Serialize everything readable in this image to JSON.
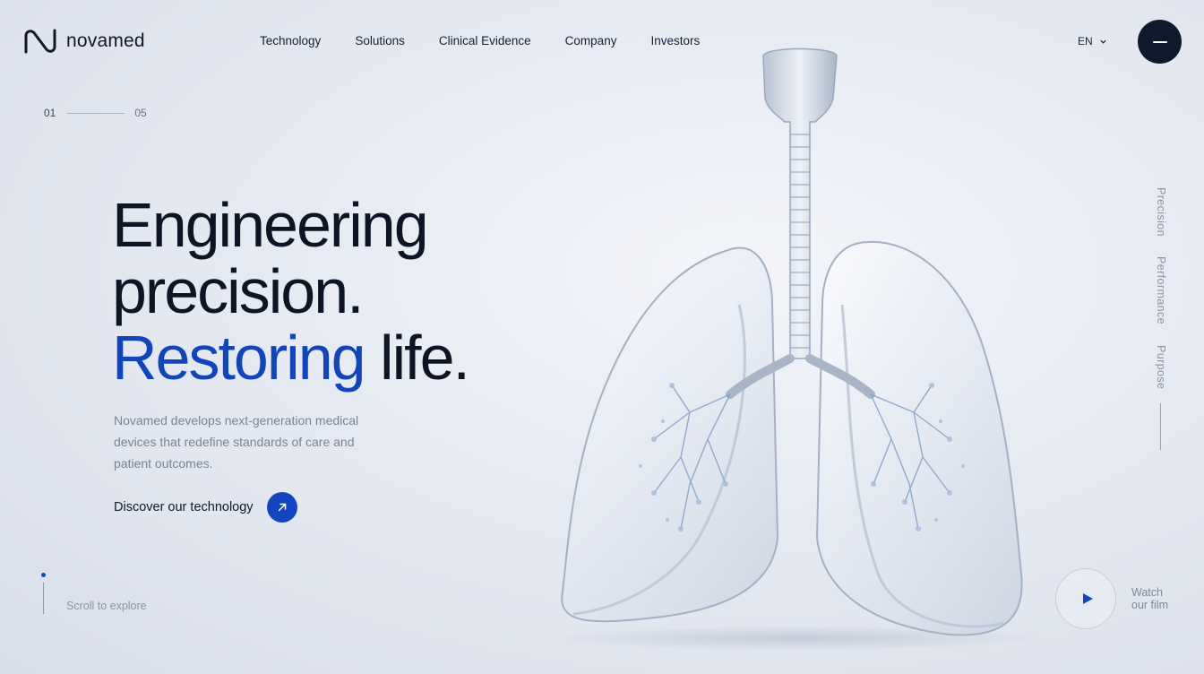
{
  "brand": {
    "name": "novamed"
  },
  "nav": {
    "items": [
      "Technology",
      "Solutions",
      "Clinical Evidence",
      "Company",
      "Investors"
    ]
  },
  "language": {
    "selected": "EN"
  },
  "counter": {
    "current": "01",
    "total": "05"
  },
  "hero": {
    "line1": "Engineering",
    "line2": "precision.",
    "line3_accent": "Restoring",
    "line3_rest": "life.",
    "description": "Novamed develops next-generation medical devices that redefine standards of care and patient outcomes.",
    "cta_label": "Discover our technology"
  },
  "scroll": {
    "label": "Scroll to explore"
  },
  "side_nav": {
    "items": [
      "Precision",
      "Performance",
      "Purpose"
    ]
  },
  "film": {
    "line1": "Watch",
    "line2": "our film"
  },
  "colors": {
    "accent": "#1146c0",
    "dark": "#0e1a2b",
    "background": "#e6eaf2"
  },
  "icons": [
    "logo-mark-icon",
    "chevron-down-icon",
    "menu-icon",
    "arrow-up-right-icon",
    "play-icon"
  ]
}
